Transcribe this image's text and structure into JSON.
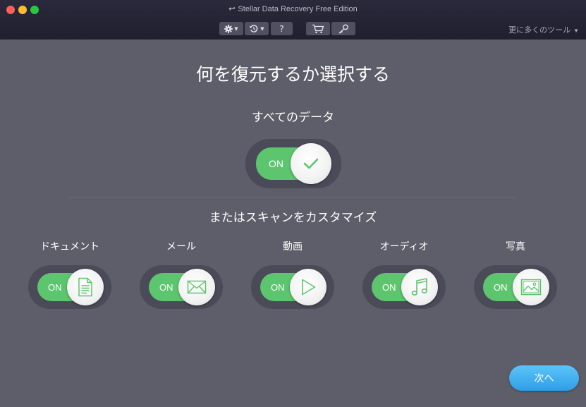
{
  "window": {
    "title": "Stellar Data Recovery Free Edition"
  },
  "toolbar": {
    "help_label": "?",
    "more_tools": "更に多くのツール",
    "more_tools_arrow": "▼"
  },
  "main": {
    "heading": "何を復元するか選択する",
    "all_data": {
      "label": "すべてのデータ",
      "toggle": "ON",
      "state": "on"
    },
    "custom_heading": "またはスキャンをカスタマイズ",
    "categories": [
      {
        "label": "ドキュメント",
        "toggle": "ON",
        "icon": "document-icon"
      },
      {
        "label": "メール",
        "toggle": "ON",
        "icon": "mail-icon"
      },
      {
        "label": "動画",
        "toggle": "ON",
        "icon": "play-icon"
      },
      {
        "label": "オーディオ",
        "toggle": "ON",
        "icon": "music-note-icon"
      },
      {
        "label": "写真",
        "toggle": "ON",
        "icon": "image-icon"
      }
    ]
  },
  "footer": {
    "next_label": "次へ"
  },
  "colors": {
    "accent_green": "#5cc56e",
    "button_blue": "#3aa8ee",
    "background": "#5e5e6a",
    "titlebar": "#24243a"
  }
}
